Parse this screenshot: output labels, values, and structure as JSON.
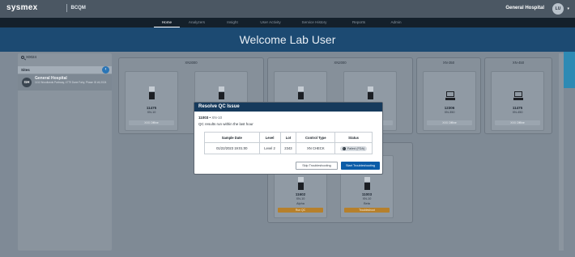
{
  "header": {
    "brand": "sysmex",
    "brand_sub": "",
    "app_name": "BCQM",
    "hospital": "General Hospital",
    "avatar_initials": "LU"
  },
  "nav": {
    "items": [
      {
        "label": "Home",
        "active": true
      },
      {
        "label": "Analyzers",
        "active": false
      },
      {
        "label": "Insight",
        "active": false
      },
      {
        "label": "User Activity",
        "active": false
      },
      {
        "label": "Service History",
        "active": false
      },
      {
        "label": "Reports",
        "active": false
      },
      {
        "label": "Admin",
        "active": false
      }
    ]
  },
  "banner": {
    "welcome": "Welcome Lab User"
  },
  "sidebar": {
    "search_value": "X0024",
    "sites_label": "Sites",
    "site": {
      "badge": "GH",
      "name": "General Hospital",
      "address": "1111 Woodlands Parkway, 4779 Dane Fairy, Phase ID #4,0024"
    }
  },
  "groups": [
    {
      "title": "XN3000"
    },
    {
      "title": "XN2000"
    },
    {
      "title": "XN-350"
    },
    {
      "title": "XN-450"
    }
  ],
  "devices": [
    {
      "id": "11475",
      "model": "XN-10",
      "sub": "",
      "status": "XXX Offline",
      "amber": false
    },
    {
      "id": "",
      "model": "",
      "sub": "",
      "status": "",
      "amber": false
    },
    {
      "id": "",
      "model": "",
      "sub": "",
      "status": "",
      "amber": false
    },
    {
      "id": "",
      "model": "",
      "sub": "",
      "status": "",
      "amber": false
    },
    {
      "id": "12306",
      "model": "XN-350",
      "sub": "",
      "status": "XXX Offline",
      "amber": false
    },
    {
      "id": "11475",
      "model": "XN-450",
      "sub": "",
      "status": "XXX Offline",
      "amber": false
    },
    {
      "id": "11602",
      "model": "XN-10",
      "sub": "Alpha",
      "status": "Run QC",
      "amber": true
    },
    {
      "id": "11003",
      "model": "XN-10",
      "sub": "Beta",
      "status": "Troubleshoot",
      "amber": true
    }
  ],
  "modal": {
    "title": "Resolve QC Issue",
    "device_id": "11003",
    "device_model": "XN-10",
    "subtitle": "QC results run within the last hour",
    "columns": [
      "Sample Date",
      "Level",
      "Lot",
      "Control Type",
      "Status"
    ],
    "row": {
      "sample_date": "01/22/2023 19:01:00",
      "level": "Level 2",
      "lot": "2343",
      "control_type": "XN CHECK",
      "status": "Failed (FDA)"
    },
    "skip_label": "Skip Troubleshooting",
    "start_label": "Start Troubleshooting"
  }
}
